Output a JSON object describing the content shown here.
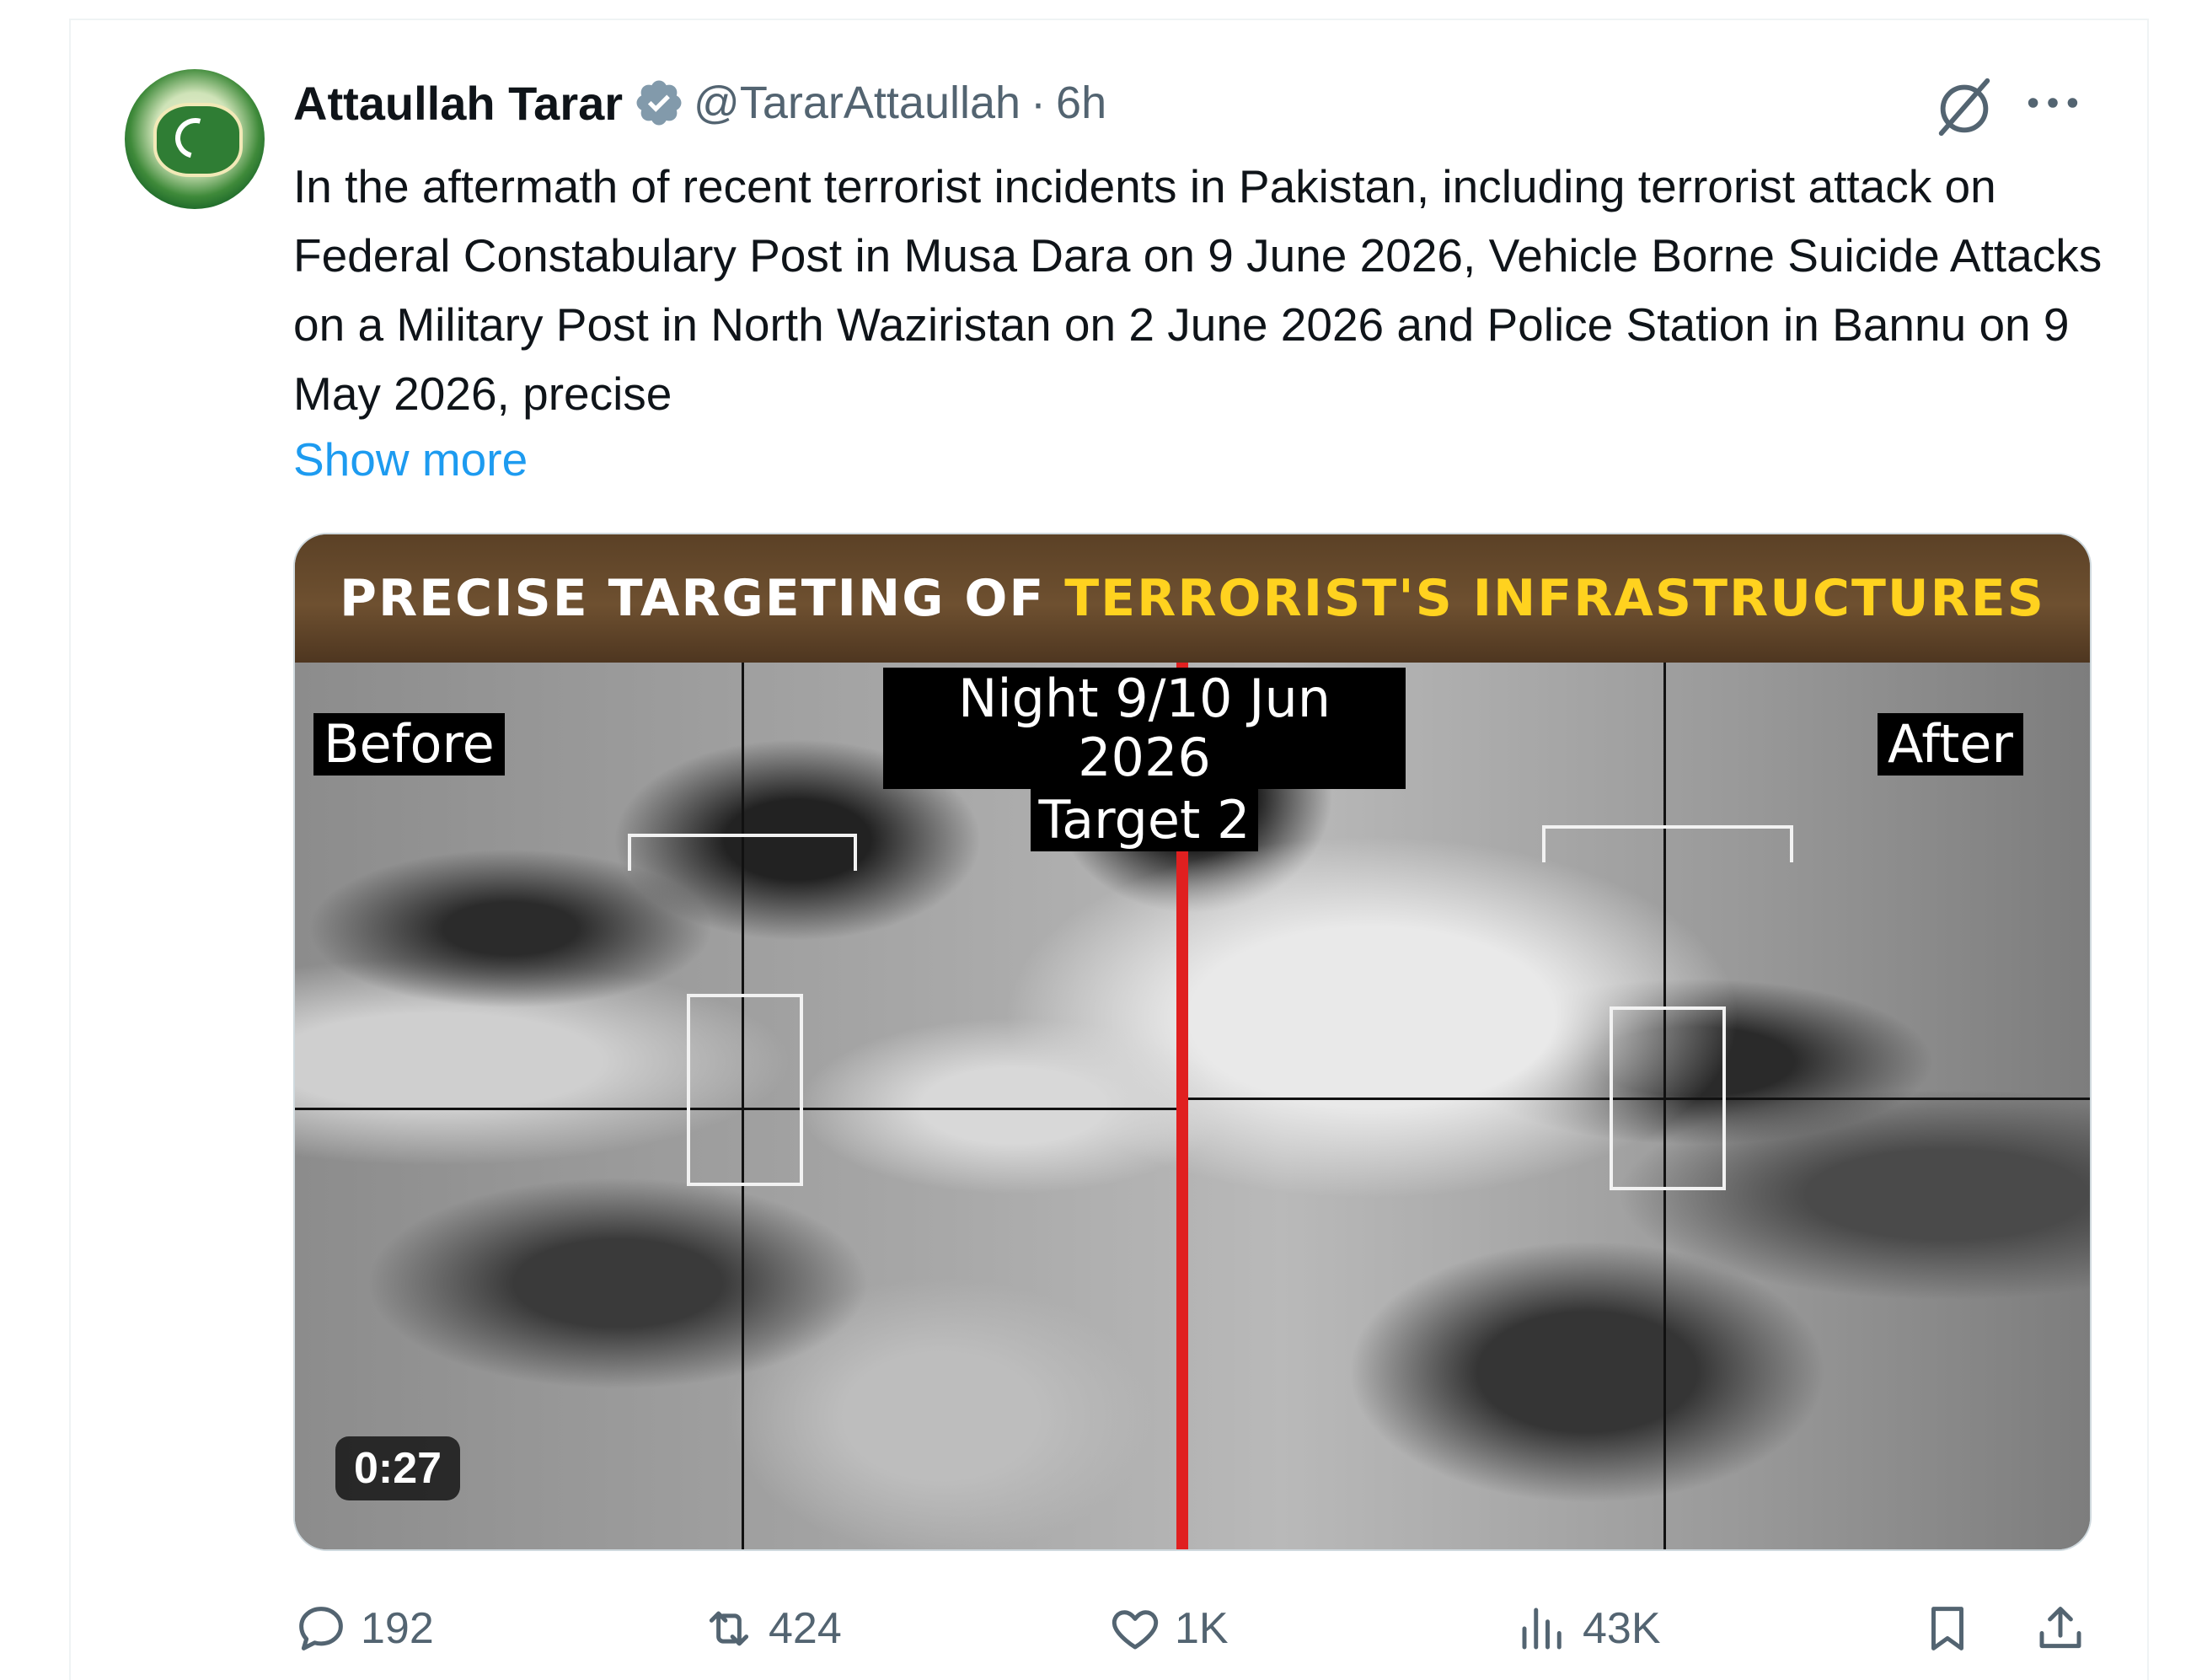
{
  "tweet": {
    "author": {
      "name": "Attaullah Tarar",
      "handle": "@TararAttaullah",
      "separator": "·",
      "time": "6h",
      "verified": true,
      "verified_color": "#829aab"
    },
    "text": "In the aftermath of recent terrorist incidents in Pakistan, including terrorist attack on Federal Constabulary Post in Musa Dara on 9 June 2026, Vehicle Borne Suicide Attacks on a Military Post in North Waziristan on 2 June 2026 and Police Station in Bannu on 9 May 2026, precise",
    "show_more": "Show more",
    "media": {
      "banner_white": "PRECISE TARGETING OF",
      "banner_yellow": "TERRORIST'S INFRASTRUCTURES",
      "label_before": "Before",
      "label_after": "After",
      "center_line1": "Night 9/10 Jun 2026",
      "center_line2": "Target 2",
      "duration": "0:27",
      "accent_line_color": "#e02020",
      "banner_highlight_color": "#ffd21f"
    },
    "actions": {
      "replies": "192",
      "reposts": "424",
      "likes": "1K",
      "views": "43K"
    },
    "colors": {
      "link": "#1d9bf0",
      "secondary_text": "#536471",
      "primary_text": "#0f1419"
    }
  }
}
